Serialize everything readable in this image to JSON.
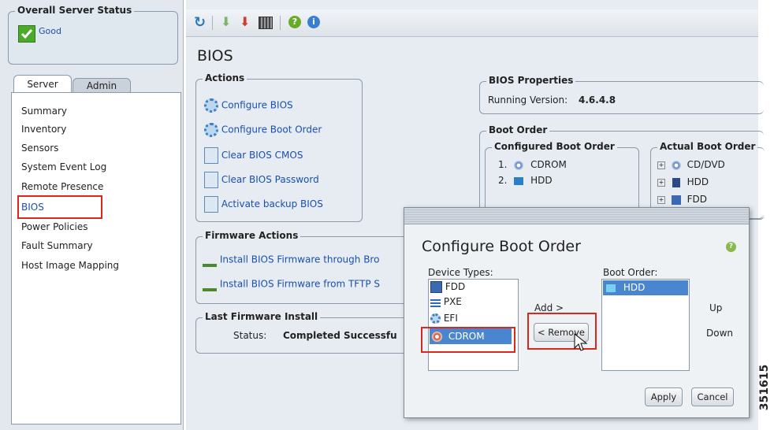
{
  "sidebar": {
    "status_title": "Overall Server Status",
    "status_value": "Good",
    "tabs": [
      {
        "label": "Server"
      },
      {
        "label": "Admin"
      }
    ],
    "items": [
      {
        "label": "Summary"
      },
      {
        "label": "Inventory"
      },
      {
        "label": "Sensors"
      },
      {
        "label": "System Event Log"
      },
      {
        "label": "Remote Presence"
      },
      {
        "label": "BIOS"
      },
      {
        "label": "Power Policies"
      },
      {
        "label": "Fault Summary"
      },
      {
        "label": "Host Image Mapping"
      }
    ]
  },
  "toolbar": {
    "icons": [
      "refresh-icon",
      "download-green-icon",
      "download-red-icon",
      "keyboard-icon",
      "help-icon",
      "info-icon"
    ]
  },
  "main": {
    "title": "BIOS",
    "actions": {
      "title": "Actions",
      "items": [
        {
          "label": "Configure BIOS",
          "icon": "gear-icon"
        },
        {
          "label": "Configure Boot Order",
          "icon": "gear-icon"
        },
        {
          "label": "Clear BIOS CMOS",
          "icon": "document-icon"
        },
        {
          "label": "Clear BIOS Password",
          "icon": "document-icon"
        },
        {
          "label": "Activate backup BIOS",
          "icon": "document-icon"
        }
      ]
    },
    "firmware_actions": {
      "title": "Firmware Actions",
      "items": [
        {
          "label": "Install BIOS Firmware through Bro"
        },
        {
          "label": "Install BIOS Firmware from TFTP S"
        }
      ]
    },
    "last_install": {
      "title": "Last Firmware Install",
      "status_label": "Status:",
      "status_value": "Completed Successfu"
    },
    "bios_properties": {
      "title": "BIOS Properties",
      "running_version_label": "Running Version:",
      "running_version_value": "4.6.4.8"
    },
    "boot_order": {
      "title": "Boot Order",
      "configured_title": "Configured Boot Order",
      "configured_items": [
        {
          "num": "1.",
          "label": "CDROM"
        },
        {
          "num": "2.",
          "label": "HDD"
        }
      ],
      "actual_title": "Actual Boot Order",
      "actual_items": [
        {
          "label": "CD/DVD"
        },
        {
          "label": "HDD"
        },
        {
          "label": "FDD"
        }
      ]
    }
  },
  "dialog": {
    "title": "Configure Boot Order",
    "device_types_label": "Device Types:",
    "device_types": [
      {
        "label": "FDD",
        "icon": "floppy-icon"
      },
      {
        "label": "PXE",
        "icon": "network-icon"
      },
      {
        "label": "EFI",
        "icon": "gear-icon"
      },
      {
        "label": "CDROM",
        "icon": "cdrom-icon"
      }
    ],
    "add_label": "Add >",
    "remove_label": "< Remove",
    "boot_order_label": "Boot Order:",
    "boot_order_items": [
      {
        "label": "HDD"
      }
    ],
    "up_label": "Up",
    "down_label": "Down",
    "apply_label": "Apply",
    "cancel_label": "Cancel"
  },
  "figure_id": "351615",
  "colors": {
    "highlight_red": "#d9281f",
    "selection_blue": "#4a86d0",
    "link_blue": "#1a4fb0"
  }
}
